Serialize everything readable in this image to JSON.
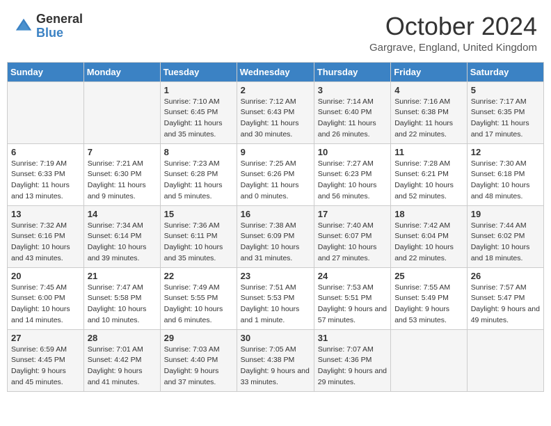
{
  "header": {
    "logo_general": "General",
    "logo_blue": "Blue",
    "month_title": "October 2024",
    "location": "Gargrave, England, United Kingdom"
  },
  "days_of_week": [
    "Sunday",
    "Monday",
    "Tuesday",
    "Wednesday",
    "Thursday",
    "Friday",
    "Saturday"
  ],
  "weeks": [
    [
      {
        "day": "",
        "sunrise": "",
        "sunset": "",
        "daylight": ""
      },
      {
        "day": "",
        "sunrise": "",
        "sunset": "",
        "daylight": ""
      },
      {
        "day": "1",
        "sunrise": "Sunrise: 7:10 AM",
        "sunset": "Sunset: 6:45 PM",
        "daylight": "Daylight: 11 hours and 35 minutes."
      },
      {
        "day": "2",
        "sunrise": "Sunrise: 7:12 AM",
        "sunset": "Sunset: 6:43 PM",
        "daylight": "Daylight: 11 hours and 30 minutes."
      },
      {
        "day": "3",
        "sunrise": "Sunrise: 7:14 AM",
        "sunset": "Sunset: 6:40 PM",
        "daylight": "Daylight: 11 hours and 26 minutes."
      },
      {
        "day": "4",
        "sunrise": "Sunrise: 7:16 AM",
        "sunset": "Sunset: 6:38 PM",
        "daylight": "Daylight: 11 hours and 22 minutes."
      },
      {
        "day": "5",
        "sunrise": "Sunrise: 7:17 AM",
        "sunset": "Sunset: 6:35 PM",
        "daylight": "Daylight: 11 hours and 17 minutes."
      }
    ],
    [
      {
        "day": "6",
        "sunrise": "Sunrise: 7:19 AM",
        "sunset": "Sunset: 6:33 PM",
        "daylight": "Daylight: 11 hours and 13 minutes."
      },
      {
        "day": "7",
        "sunrise": "Sunrise: 7:21 AM",
        "sunset": "Sunset: 6:30 PM",
        "daylight": "Daylight: 11 hours and 9 minutes."
      },
      {
        "day": "8",
        "sunrise": "Sunrise: 7:23 AM",
        "sunset": "Sunset: 6:28 PM",
        "daylight": "Daylight: 11 hours and 5 minutes."
      },
      {
        "day": "9",
        "sunrise": "Sunrise: 7:25 AM",
        "sunset": "Sunset: 6:26 PM",
        "daylight": "Daylight: 11 hours and 0 minutes."
      },
      {
        "day": "10",
        "sunrise": "Sunrise: 7:27 AM",
        "sunset": "Sunset: 6:23 PM",
        "daylight": "Daylight: 10 hours and 56 minutes."
      },
      {
        "day": "11",
        "sunrise": "Sunrise: 7:28 AM",
        "sunset": "Sunset: 6:21 PM",
        "daylight": "Daylight: 10 hours and 52 minutes."
      },
      {
        "day": "12",
        "sunrise": "Sunrise: 7:30 AM",
        "sunset": "Sunset: 6:18 PM",
        "daylight": "Daylight: 10 hours and 48 minutes."
      }
    ],
    [
      {
        "day": "13",
        "sunrise": "Sunrise: 7:32 AM",
        "sunset": "Sunset: 6:16 PM",
        "daylight": "Daylight: 10 hours and 43 minutes."
      },
      {
        "day": "14",
        "sunrise": "Sunrise: 7:34 AM",
        "sunset": "Sunset: 6:14 PM",
        "daylight": "Daylight: 10 hours and 39 minutes."
      },
      {
        "day": "15",
        "sunrise": "Sunrise: 7:36 AM",
        "sunset": "Sunset: 6:11 PM",
        "daylight": "Daylight: 10 hours and 35 minutes."
      },
      {
        "day": "16",
        "sunrise": "Sunrise: 7:38 AM",
        "sunset": "Sunset: 6:09 PM",
        "daylight": "Daylight: 10 hours and 31 minutes."
      },
      {
        "day": "17",
        "sunrise": "Sunrise: 7:40 AM",
        "sunset": "Sunset: 6:07 PM",
        "daylight": "Daylight: 10 hours and 27 minutes."
      },
      {
        "day": "18",
        "sunrise": "Sunrise: 7:42 AM",
        "sunset": "Sunset: 6:04 PM",
        "daylight": "Daylight: 10 hours and 22 minutes."
      },
      {
        "day": "19",
        "sunrise": "Sunrise: 7:44 AM",
        "sunset": "Sunset: 6:02 PM",
        "daylight": "Daylight: 10 hours and 18 minutes."
      }
    ],
    [
      {
        "day": "20",
        "sunrise": "Sunrise: 7:45 AM",
        "sunset": "Sunset: 6:00 PM",
        "daylight": "Daylight: 10 hours and 14 minutes."
      },
      {
        "day": "21",
        "sunrise": "Sunrise: 7:47 AM",
        "sunset": "Sunset: 5:58 PM",
        "daylight": "Daylight: 10 hours and 10 minutes."
      },
      {
        "day": "22",
        "sunrise": "Sunrise: 7:49 AM",
        "sunset": "Sunset: 5:55 PM",
        "daylight": "Daylight: 10 hours and 6 minutes."
      },
      {
        "day": "23",
        "sunrise": "Sunrise: 7:51 AM",
        "sunset": "Sunset: 5:53 PM",
        "daylight": "Daylight: 10 hours and 1 minute."
      },
      {
        "day": "24",
        "sunrise": "Sunrise: 7:53 AM",
        "sunset": "Sunset: 5:51 PM",
        "daylight": "Daylight: 9 hours and 57 minutes."
      },
      {
        "day": "25",
        "sunrise": "Sunrise: 7:55 AM",
        "sunset": "Sunset: 5:49 PM",
        "daylight": "Daylight: 9 hours and 53 minutes."
      },
      {
        "day": "26",
        "sunrise": "Sunrise: 7:57 AM",
        "sunset": "Sunset: 5:47 PM",
        "daylight": "Daylight: 9 hours and 49 minutes."
      }
    ],
    [
      {
        "day": "27",
        "sunrise": "Sunrise: 6:59 AM",
        "sunset": "Sunset: 4:45 PM",
        "daylight": "Daylight: 9 hours and 45 minutes."
      },
      {
        "day": "28",
        "sunrise": "Sunrise: 7:01 AM",
        "sunset": "Sunset: 4:42 PM",
        "daylight": "Daylight: 9 hours and 41 minutes."
      },
      {
        "day": "29",
        "sunrise": "Sunrise: 7:03 AM",
        "sunset": "Sunset: 4:40 PM",
        "daylight": "Daylight: 9 hours and 37 minutes."
      },
      {
        "day": "30",
        "sunrise": "Sunrise: 7:05 AM",
        "sunset": "Sunset: 4:38 PM",
        "daylight": "Daylight: 9 hours and 33 minutes."
      },
      {
        "day": "31",
        "sunrise": "Sunrise: 7:07 AM",
        "sunset": "Sunset: 4:36 PM",
        "daylight": "Daylight: 9 hours and 29 minutes."
      },
      {
        "day": "",
        "sunrise": "",
        "sunset": "",
        "daylight": ""
      },
      {
        "day": "",
        "sunrise": "",
        "sunset": "",
        "daylight": ""
      }
    ]
  ]
}
